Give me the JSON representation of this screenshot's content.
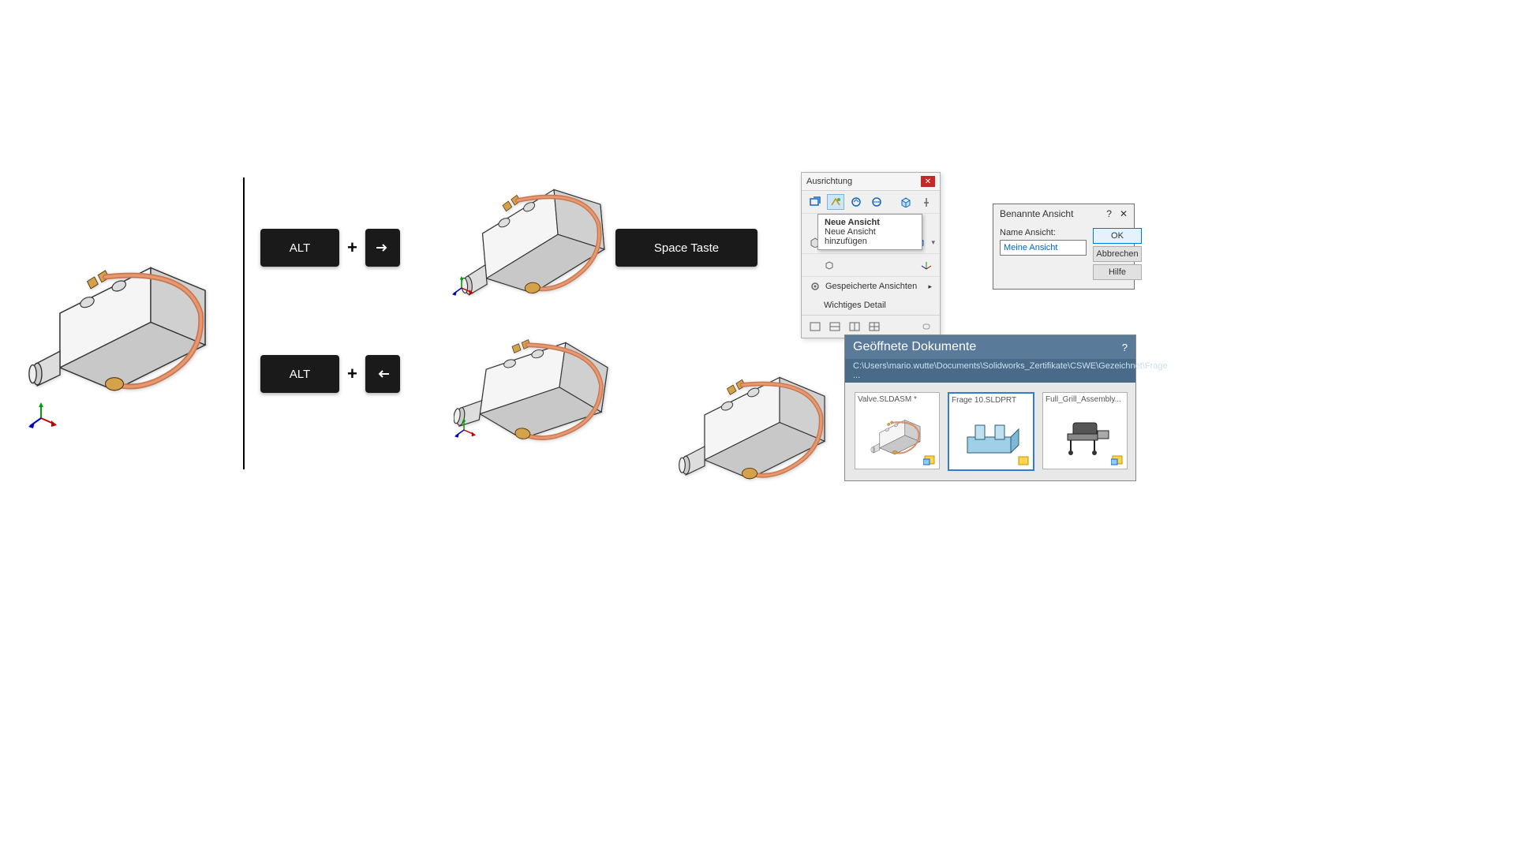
{
  "keys": {
    "alt": "ALT",
    "space": "Space Taste"
  },
  "orientation": {
    "title": "Ausrichtung",
    "tooltip_title": "Neue Ansicht",
    "tooltip_sub": "Neue Ansicht hinzufügen",
    "saved_views": "Gespeicherte Ansichten",
    "detail": "Wichtiges Detail"
  },
  "dialog": {
    "title": "Benannte Ansicht",
    "label": "Name Ansicht:",
    "value": "Meine Ansicht",
    "ok": "OK",
    "cancel": "Abbrechen",
    "help": "Hilfe"
  },
  "docs": {
    "title": "Geöffnete Dokumente",
    "path": "C:\\Users\\mario.wutte\\Documents\\Solidworks_Zertifikate\\CSWE\\Gezeichnet\\Frage ...",
    "items": [
      "Valve.SLDASM *",
      "Frage 10.SLDPRT",
      "Full_Grill_Assembly..."
    ]
  }
}
